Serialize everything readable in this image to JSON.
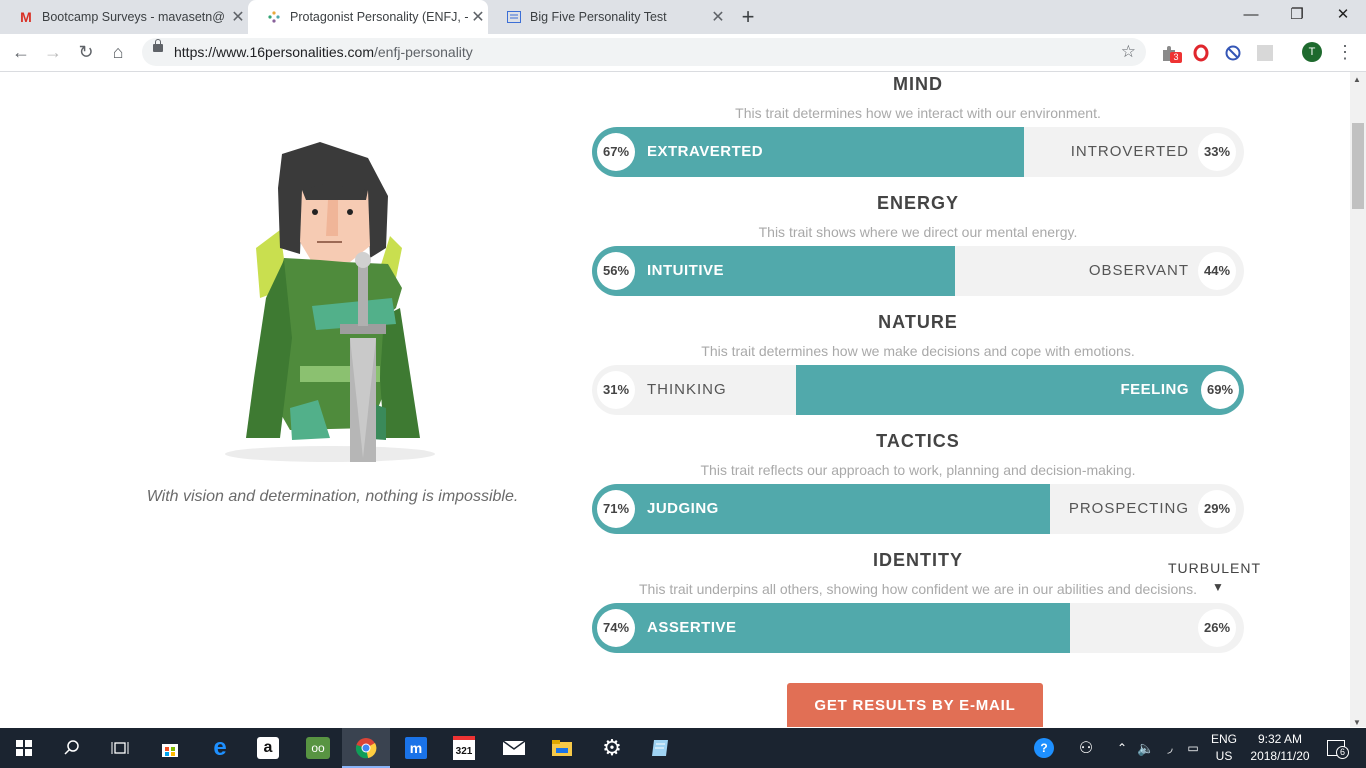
{
  "browser": {
    "tabs": [
      {
        "title": "Bootcamp Surveys - mavasetn@",
        "icon": "gmail-icon"
      },
      {
        "title": "Protagonist Personality (ENFJ, -A",
        "icon": "16personalities-icon"
      },
      {
        "title": "Big Five Personality Test",
        "icon": "document-icon"
      }
    ],
    "url_host": "https://www.16personalities.com",
    "url_path": "/enfj-personality",
    "extension_badge": "3",
    "profile_initial": "T"
  },
  "page": {
    "quote": "With vision and determination, nothing is impossible.",
    "traits": [
      {
        "name": "MIND",
        "desc": "This trait determines how we interact with our environment.",
        "left_label": "EXTRAVERTED",
        "left_pct": "67%",
        "right_label": "INTROVERTED",
        "right_pct": "33%",
        "dominant": "left",
        "value": 67
      },
      {
        "name": "ENERGY",
        "desc": "This trait shows where we direct our mental energy.",
        "left_label": "INTUITIVE",
        "left_pct": "56%",
        "right_label": "OBSERVANT",
        "right_pct": "44%",
        "dominant": "left",
        "value": 56
      },
      {
        "name": "NATURE",
        "desc": "This trait determines how we make decisions and cope with emotions.",
        "left_label": "THINKING",
        "left_pct": "31%",
        "right_label": "FEELING",
        "right_pct": "69%",
        "dominant": "right",
        "value": 69
      },
      {
        "name": "TACTICS",
        "desc": "This trait reflects our approach to work, planning and decision-making.",
        "left_label": "JUDGING",
        "left_pct": "71%",
        "right_label": "PROSPECTING",
        "right_pct": "29%",
        "dominant": "left",
        "value": 71
      },
      {
        "name": "IDENTITY",
        "desc": "This trait underpins all others, showing how confident we are in our abilities and decisions.",
        "left_label": "ASSERTIVE",
        "left_pct": "74%",
        "right_label": "",
        "right_pct": "26%",
        "dominant": "left",
        "value": 74
      }
    ],
    "turbulent_label": "TURBULENT",
    "email_button": "GET RESULTS BY E-MAIL",
    "accent_color": "#51a9ab",
    "button_color": "#e16f55"
  },
  "taskbar": {
    "language_top": "ENG",
    "language_bottom": "US",
    "time": "9:32 AM",
    "date": "2018/11/20",
    "notification_count": "6",
    "calendar_day": "321"
  }
}
